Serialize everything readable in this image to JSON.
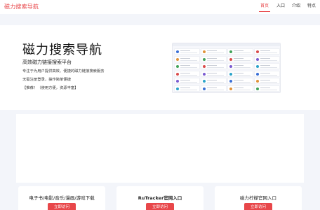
{
  "header": {
    "brand": "磁力搜索导航",
    "nav": [
      "首页",
      "入口",
      "介绍",
      "特点"
    ],
    "active_index": 0,
    "accent_color": "#e8474a"
  },
  "hero": {
    "title": "磁力搜索导航",
    "subtitle": "高效磁力链接搜索平台",
    "lines": [
      "专注于为用户提供高效、便捷的磁力链接搜索服务",
      "无需注册登录，操作简单便捷",
      "【推荐！（使用方便，资源丰富】"
    ]
  },
  "cards": [
    {
      "title": "电子书/电影/音乐/漫画/游戏下载",
      "button": "立即访问",
      "bold": false
    },
    {
      "title": "RuTracker官网入口",
      "button": "立即访问",
      "bold": true
    },
    {
      "title": "磁力柠檬官网入口",
      "button": "立即访问",
      "bold": false
    }
  ]
}
